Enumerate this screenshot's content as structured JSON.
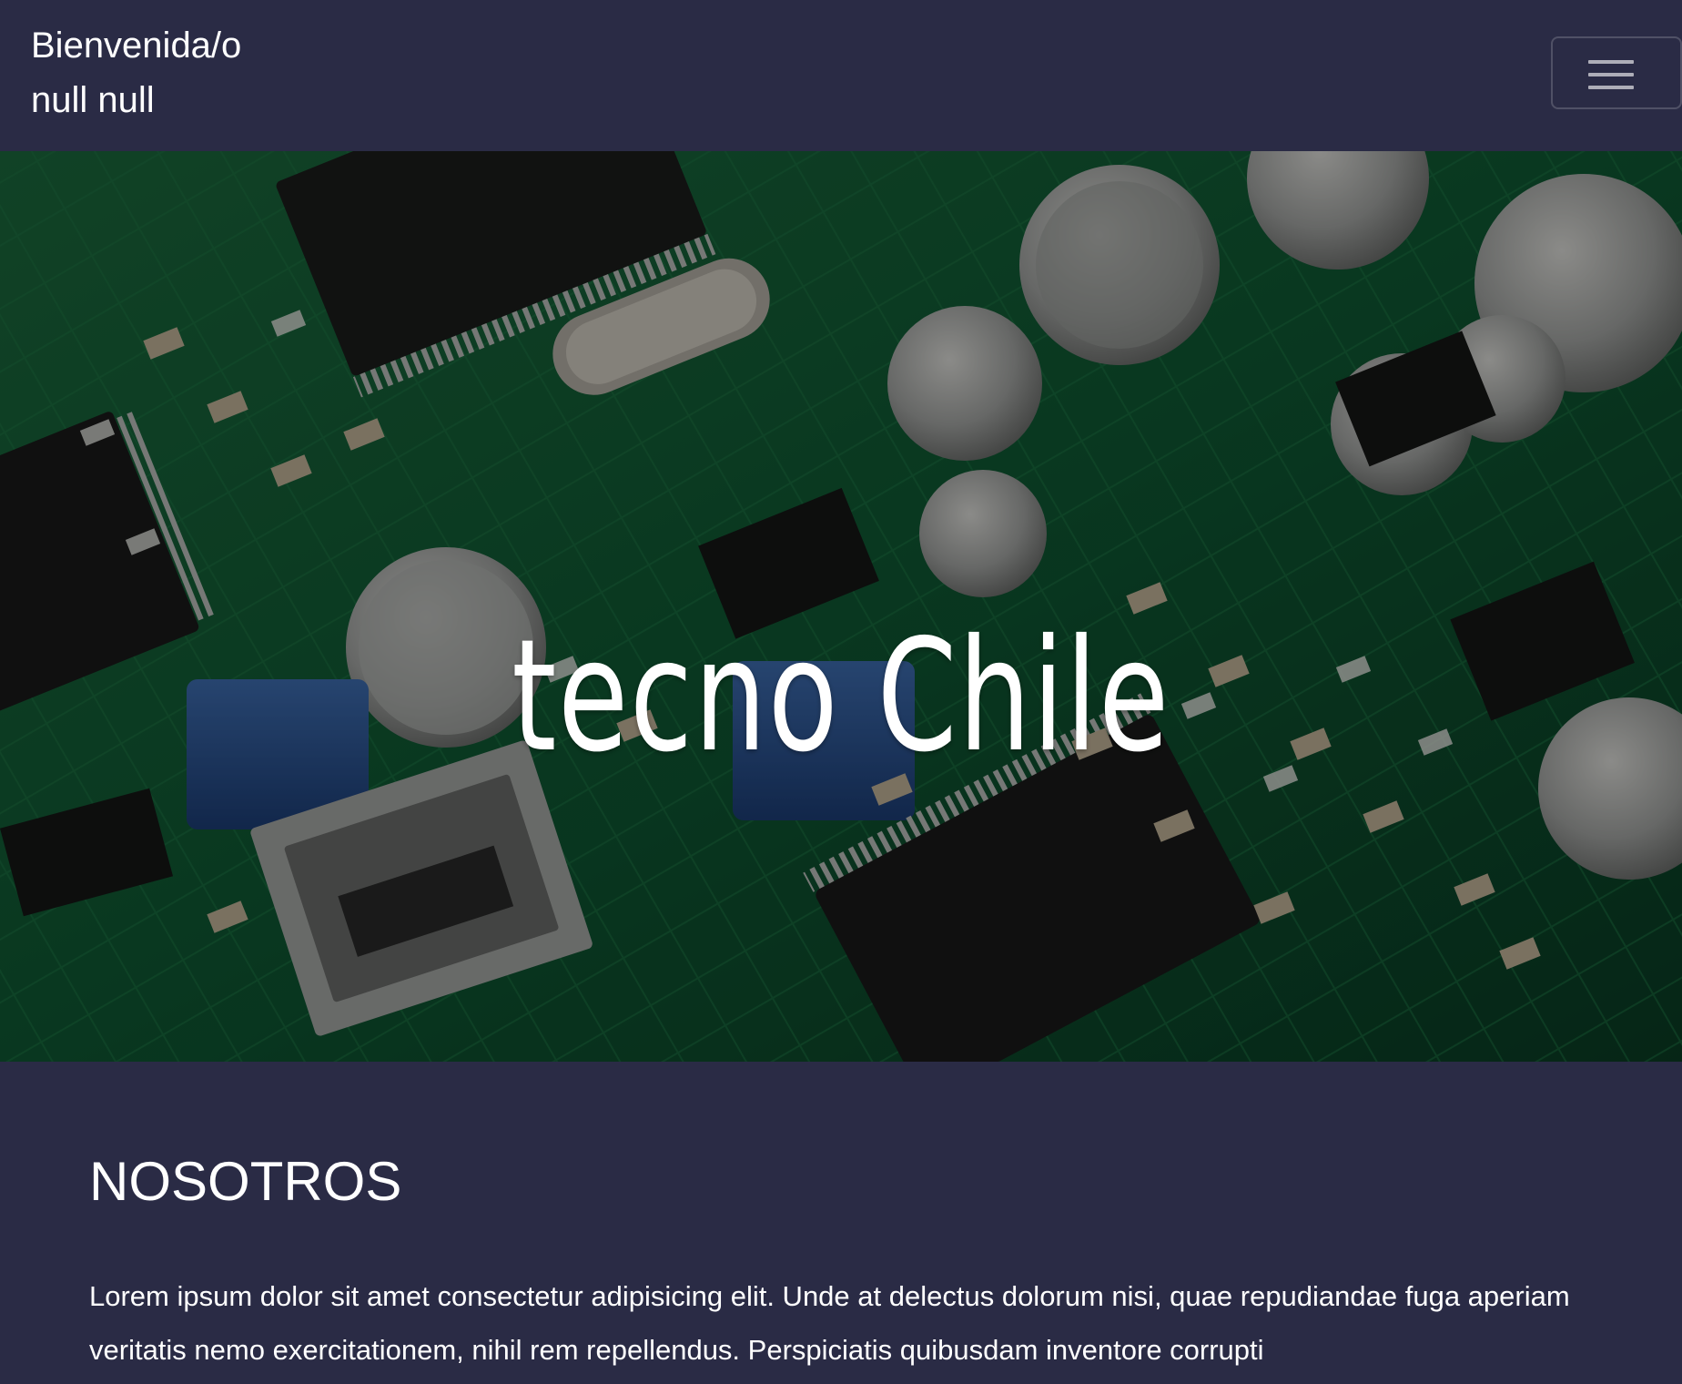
{
  "navbar": {
    "greeting_line1": "Bienvenida/o",
    "greeting_line2": "null null",
    "toggle_icon": "hamburger-menu-icon"
  },
  "hero": {
    "title": "tecno Chile",
    "background_image": "circuit-board-photo"
  },
  "about": {
    "title": "NOSOTROS",
    "text": "Lorem ipsum dolor sit amet consectetur adipisicing elit. Unde at delectus dolorum nisi, quae repudiandae fuga aperiam veritatis nemo exercitationem, nihil rem repellendus. Perspiciatis quibusdam inventore corrupti"
  },
  "colors": {
    "background": "#2a2b45",
    "text": "#ffffff",
    "pcb_green": "#0f5a34"
  }
}
